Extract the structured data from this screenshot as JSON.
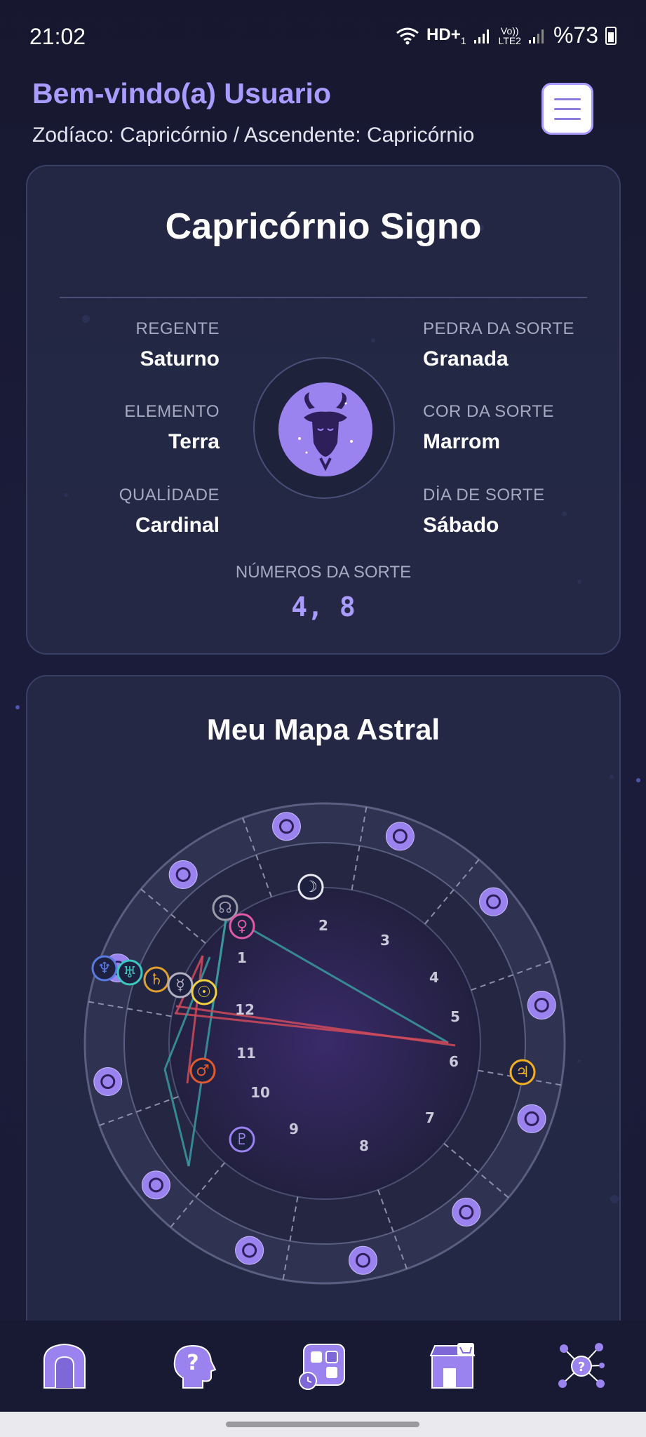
{
  "status_bar": {
    "time": "21:02",
    "net_label": "HD+",
    "net_sub": "1",
    "volte": "Vo))",
    "lte": "LTE2",
    "battery": "%73"
  },
  "header": {
    "welcome": "Bem-vindo(a) Usuario",
    "zodiac_line": "Zodíaco: Capricórnio / Ascendente: Capricórnio",
    "menu_icon": "hamburger-menu-icon"
  },
  "sign_card": {
    "title": "Capricórnio Signo",
    "attributes_left": [
      {
        "label": "REGENTE",
        "value": "Saturno"
      },
      {
        "label": "ELEMENTO",
        "value": "Terra"
      },
      {
        "label": "QUALİDADE",
        "value": "Cardinal"
      }
    ],
    "attributes_right": [
      {
        "label": "PEDRA DA SORTE",
        "value": "Granada"
      },
      {
        "label": "COR DA SORTE",
        "value": "Marrom"
      },
      {
        "label": "DİA DE SORTE",
        "value": "Sábado"
      }
    ],
    "lucky_numbers_label": "NÚMEROS DA SORTE",
    "lucky_numbers": "4, 8",
    "emblem_icon": "capricorn-goat-icon"
  },
  "chart_card": {
    "title": "Meu Mapa Astral",
    "house_numbers": [
      "1",
      "2",
      "3",
      "4",
      "5",
      "6",
      "7",
      "8",
      "9",
      "10",
      "11",
      "12"
    ],
    "planets": [
      {
        "symbol": "☽",
        "name": "moon",
        "color": "#e8e8f0"
      },
      {
        "symbol": "☊",
        "name": "north-node",
        "color": "#9a9aa8"
      },
      {
        "symbol": "♀",
        "name": "venus",
        "color": "#e05aa8"
      },
      {
        "symbol": "♆",
        "name": "neptune",
        "color": "#5a7ae0"
      },
      {
        "symbol": "♅",
        "name": "uranus",
        "color": "#3ac8c0"
      },
      {
        "symbol": "♄",
        "name": "saturn",
        "color": "#e0a030"
      },
      {
        "symbol": "☿",
        "name": "mercury",
        "color": "#b0b0c0"
      },
      {
        "symbol": "☉",
        "name": "sun",
        "color": "#f0d040"
      },
      {
        "symbol": "♂",
        "name": "mars",
        "color": "#e05a30"
      },
      {
        "symbol": "♃",
        "name": "jupiter",
        "color": "#f0b020"
      },
      {
        "symbol": "♇",
        "name": "pluto",
        "color": "#9a83ef"
      }
    ],
    "zodiac_icons": [
      "aries-icon",
      "taurus-icon",
      "gemini-icon",
      "cancer-icon",
      "leo-icon",
      "virgo-icon",
      "libra-icon",
      "scorpio-icon",
      "sagittarius-icon",
      "capricorn-icon",
      "aquarius-icon",
      "pisces-icon"
    ]
  },
  "bottom_nav": [
    {
      "name": "nav-home",
      "icon": "home-door-icon"
    },
    {
      "name": "nav-questions",
      "icon": "head-question-icon"
    },
    {
      "name": "nav-apps",
      "icon": "grid-clock-icon"
    },
    {
      "name": "nav-shop",
      "icon": "shop-cart-icon"
    },
    {
      "name": "nav-network",
      "icon": "network-question-icon"
    }
  ],
  "colors": {
    "accent": "#a99bff",
    "emblem": "#9a83ef",
    "aspect_red": "#d04b5a",
    "aspect_teal": "#3a9aa0"
  }
}
